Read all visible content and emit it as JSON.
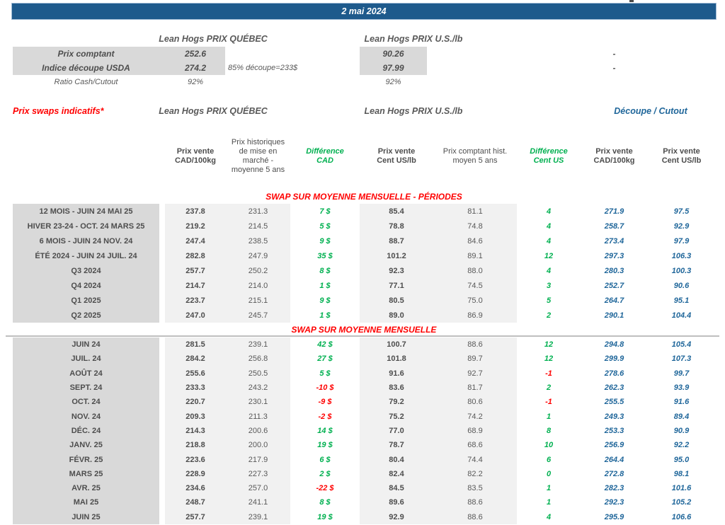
{
  "banner": {
    "date": "2 mai 2024"
  },
  "colors": {
    "banner_blue": "#1E5A8C",
    "positive_green": "#00B050",
    "negative_red": "#FF0000",
    "cutout_blue": "#1F669A",
    "label_gray": "#D9D9D9",
    "band_gray": "#F1F1F1"
  },
  "spot": {
    "quebec_header": "Lean Hogs PRIX QUÉBEC",
    "us_header": "Lean Hogs PRIX U.S./lb",
    "rows": [
      {
        "label": "Prix comptant",
        "qc": "252.6",
        "note": "",
        "us": "90.26",
        "cutout_cad": "-"
      },
      {
        "label": "Indice découpe USDA",
        "qc": "274.2",
        "note": "85% découpe=233$",
        "us": "97.99",
        "cutout_cad": "-"
      },
      {
        "label": "Ratio Cash/Cutout",
        "qc": "92%",
        "note": "",
        "us": "92%",
        "cutout_cad": ""
      }
    ]
  },
  "swaps": {
    "title": "Prix swaps indicatifs*",
    "quebec_header": "Lean Hogs PRIX QUÉBEC",
    "us_header": "Lean Hogs PRIX U.S./lb",
    "cutout_header": "Découpe / Cutout",
    "columns": [
      "Prix vente\nCAD/100kg",
      "Prix historiques\nde mise en\nmarché -\nmoyenne 5 ans",
      "Différence\nCAD",
      "Prix vente\nCent US/lb",
      "Prix comptant hist.\nmoyen 5 ans",
      "Différence\nCent US",
      "Prix vente\nCAD/100kg",
      "Prix vente\nCent US/lb"
    ],
    "sections": [
      {
        "title": "SWAP SUR MOYENNE MENSUELLE - PÉRIODES",
        "rows": [
          {
            "label": "12 MOIS - JUIN 24 MAI 25",
            "qc_sale": "237.8",
            "qc_hist": "231.3",
            "diff_cad": "7 $",
            "us_sale": "85.4",
            "us_hist": "81.1",
            "diff_us": "4",
            "cutout_cad": "271.9",
            "cutout_us": "97.5"
          },
          {
            "label": "HIVER 23-24 -  OCT. 24 MARS 25",
            "qc_sale": "219.2",
            "qc_hist": "214.5",
            "diff_cad": "5 $",
            "us_sale": "78.8",
            "us_hist": "74.8",
            "diff_us": "4",
            "cutout_cad": "258.7",
            "cutout_us": "92.9"
          },
          {
            "label": "6 MOIS -  JUIN 24 NOV. 24",
            "qc_sale": "247.4",
            "qc_hist": "238.5",
            "diff_cad": "9 $",
            "us_sale": "88.7",
            "us_hist": "84.6",
            "diff_us": "4",
            "cutout_cad": "273.4",
            "cutout_us": "97.9"
          },
          {
            "label": "ÉTÉ 2024 - JUIN 24 JUIL. 24",
            "qc_sale": "282.8",
            "qc_hist": "247.9",
            "diff_cad": "35 $",
            "us_sale": "101.2",
            "us_hist": "89.1",
            "diff_us": "12",
            "cutout_cad": "297.3",
            "cutout_us": "106.3"
          },
          {
            "label": "Q3 2024",
            "qc_sale": "257.7",
            "qc_hist": "250.2",
            "diff_cad": "8 $",
            "us_sale": "92.3",
            "us_hist": "88.0",
            "diff_us": "4",
            "cutout_cad": "280.3",
            "cutout_us": "100.3"
          },
          {
            "label": "Q4 2024",
            "qc_sale": "214.7",
            "qc_hist": "214.0",
            "diff_cad": "1 $",
            "us_sale": "77.1",
            "us_hist": "74.5",
            "diff_us": "3",
            "cutout_cad": "252.7",
            "cutout_us": "90.6"
          },
          {
            "label": "Q1 2025",
            "qc_sale": "223.7",
            "qc_hist": "215.1",
            "diff_cad": "9 $",
            "us_sale": "80.5",
            "us_hist": "75.0",
            "diff_us": "5",
            "cutout_cad": "264.7",
            "cutout_us": "95.1"
          },
          {
            "label": "Q2 2025",
            "qc_sale": "247.0",
            "qc_hist": "245.7",
            "diff_cad": "1 $",
            "us_sale": "89.0",
            "us_hist": "86.9",
            "diff_us": "2",
            "cutout_cad": "290.1",
            "cutout_us": "104.4"
          }
        ]
      },
      {
        "title": "SWAP SUR MOYENNE MENSUELLE",
        "rows": [
          {
            "label": "JUIN 24",
            "qc_sale": "281.5",
            "qc_hist": "239.1",
            "diff_cad": "42 $",
            "us_sale": "100.7",
            "us_hist": "88.6",
            "diff_us": "12",
            "cutout_cad": "294.8",
            "cutout_us": "105.4"
          },
          {
            "label": "JUIL. 24",
            "qc_sale": "284.2",
            "qc_hist": "256.8",
            "diff_cad": "27 $",
            "us_sale": "101.8",
            "us_hist": "89.7",
            "diff_us": "12",
            "cutout_cad": "299.9",
            "cutout_us": "107.3"
          },
          {
            "label": "AOÛT 24",
            "qc_sale": "255.6",
            "qc_hist": "250.5",
            "diff_cad": "5 $",
            "us_sale": "91.6",
            "us_hist": "92.7",
            "diff_us": "-1",
            "cutout_cad": "278.6",
            "cutout_us": "99.7"
          },
          {
            "label": "SEPT. 24",
            "qc_sale": "233.3",
            "qc_hist": "243.2",
            "diff_cad": "-10 $",
            "us_sale": "83.6",
            "us_hist": "81.7",
            "diff_us": "2",
            "cutout_cad": "262.3",
            "cutout_us": "93.9"
          },
          {
            "label": "OCT. 24",
            "qc_sale": "220.7",
            "qc_hist": "230.1",
            "diff_cad": "-9 $",
            "us_sale": "79.2",
            "us_hist": "80.6",
            "diff_us": "-1",
            "cutout_cad": "255.5",
            "cutout_us": "91.6"
          },
          {
            "label": "NOV. 24",
            "qc_sale": "209.3",
            "qc_hist": "211.3",
            "diff_cad": "-2 $",
            "us_sale": "75.2",
            "us_hist": "74.2",
            "diff_us": "1",
            "cutout_cad": "249.3",
            "cutout_us": "89.4"
          },
          {
            "label": "DÉC. 24",
            "qc_sale": "214.3",
            "qc_hist": "200.6",
            "diff_cad": "14 $",
            "us_sale": "77.0",
            "us_hist": "68.9",
            "diff_us": "8",
            "cutout_cad": "253.3",
            "cutout_us": "90.9"
          },
          {
            "label": "JANV. 25",
            "qc_sale": "218.8",
            "qc_hist": "200.0",
            "diff_cad": "19 $",
            "us_sale": "78.7",
            "us_hist": "68.6",
            "diff_us": "10",
            "cutout_cad": "256.9",
            "cutout_us": "92.2"
          },
          {
            "label": "FÉVR. 25",
            "qc_sale": "223.6",
            "qc_hist": "217.9",
            "diff_cad": "6 $",
            "us_sale": "80.4",
            "us_hist": "74.4",
            "diff_us": "6",
            "cutout_cad": "264.4",
            "cutout_us": "95.0"
          },
          {
            "label": "MARS 25",
            "qc_sale": "228.9",
            "qc_hist": "227.3",
            "diff_cad": "2 $",
            "us_sale": "82.4",
            "us_hist": "82.2",
            "diff_us": "0",
            "cutout_cad": "272.8",
            "cutout_us": "98.1"
          },
          {
            "label": "AVR. 25",
            "qc_sale": "234.6",
            "qc_hist": "257.0",
            "diff_cad": "-22 $",
            "us_sale": "84.5",
            "us_hist": "83.5",
            "diff_us": "1",
            "cutout_cad": "282.3",
            "cutout_us": "101.6"
          },
          {
            "label": "MAI 25",
            "qc_sale": "248.7",
            "qc_hist": "241.1",
            "diff_cad": "8 $",
            "us_sale": "89.6",
            "us_hist": "88.6",
            "diff_us": "1",
            "cutout_cad": "292.3",
            "cutout_us": "105.2"
          },
          {
            "label": "JUIN 25",
            "qc_sale": "257.7",
            "qc_hist": "239.1",
            "diff_cad": "19 $",
            "us_sale": "92.9",
            "us_hist": "88.6",
            "diff_us": "4",
            "cutout_cad": "295.9",
            "cutout_us": "106.6"
          }
        ]
      }
    ]
  }
}
